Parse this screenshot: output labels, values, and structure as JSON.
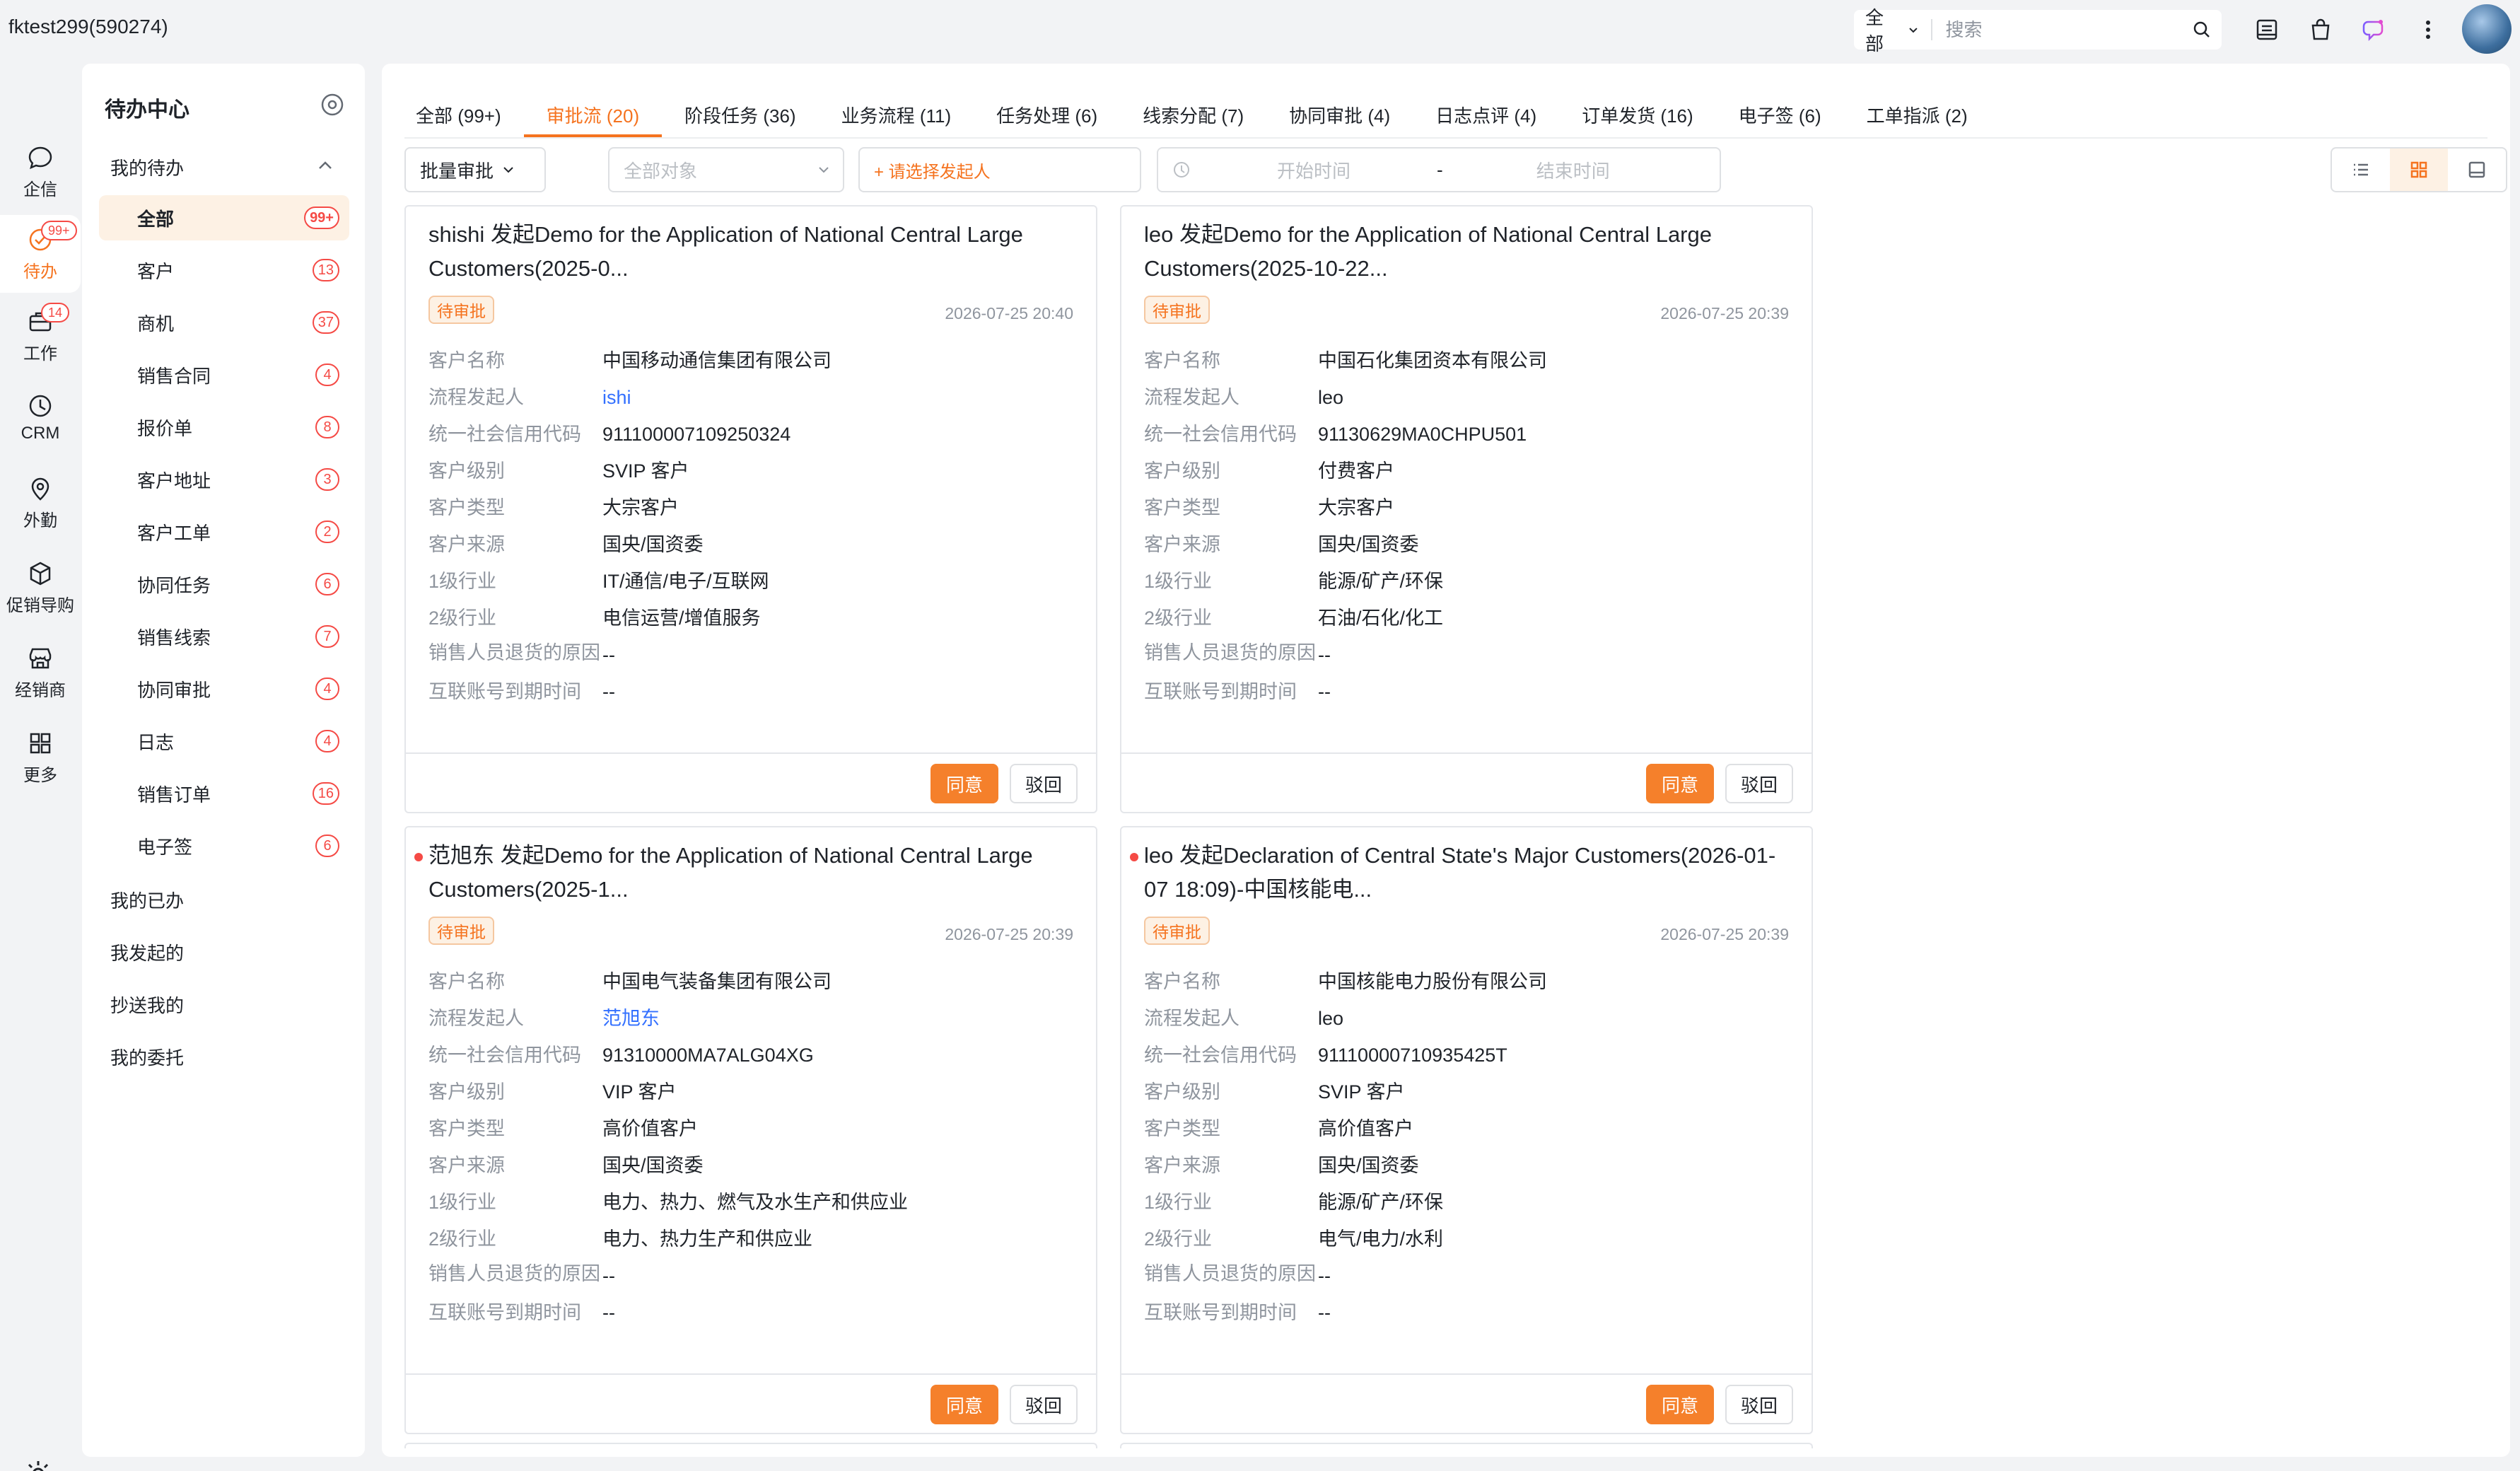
{
  "header": {
    "account": "fktest299(590274)",
    "search_scope": "全部",
    "search_placeholder": "搜索"
  },
  "rail": [
    {
      "label": "企信",
      "icon": "chat-bubble-icon"
    },
    {
      "label": "待办",
      "icon": "check-circle-icon",
      "badge": "99+",
      "active": true
    },
    {
      "label": "工作",
      "icon": "briefcase-icon",
      "badge": "14"
    },
    {
      "label": "CRM",
      "icon": "clock-icon"
    },
    {
      "label": "外勤",
      "icon": "location-pin-icon"
    },
    {
      "label": "促销导购",
      "icon": "cube-icon"
    },
    {
      "label": "经销商",
      "icon": "store-icon"
    },
    {
      "label": "更多",
      "icon": "grid-icon"
    }
  ],
  "sidebar": {
    "title": "待办中心",
    "my_todo": "我的待办",
    "items": [
      {
        "label": "全部",
        "count": "99+"
      },
      {
        "label": "客户",
        "count": "13"
      },
      {
        "label": "商机",
        "count": "37"
      },
      {
        "label": "销售合同",
        "count": "4"
      },
      {
        "label": "报价单",
        "count": "8"
      },
      {
        "label": "客户地址",
        "count": "3"
      },
      {
        "label": "客户工单",
        "count": "2"
      },
      {
        "label": "协同任务",
        "count": "6"
      },
      {
        "label": "销售线索",
        "count": "7"
      },
      {
        "label": "协同审批",
        "count": "4"
      },
      {
        "label": "日志",
        "count": "4"
      },
      {
        "label": "销售订单",
        "count": "16"
      },
      {
        "label": "电子签",
        "count": "6"
      }
    ],
    "groups": [
      "我的已办",
      "我发起的",
      "抄送我的",
      "我的委托"
    ]
  },
  "tabs": [
    {
      "label": "全部 (99+)"
    },
    {
      "label": "审批流 (20)",
      "active": true
    },
    {
      "label": "阶段任务 (36)"
    },
    {
      "label": "业务流程 (11)"
    },
    {
      "label": "任务处理 (6)"
    },
    {
      "label": "线索分配 (7)"
    },
    {
      "label": "协同审批 (4)"
    },
    {
      "label": "日志点评 (4)"
    },
    {
      "label": "订单发货 (16)"
    },
    {
      "label": "电子签 (6)"
    },
    {
      "label": "工单指派 (2)"
    }
  ],
  "filters": {
    "batch": "批量审批",
    "object_placeholder": "全部对象",
    "initiator_placeholder": "+ 请选择发起人",
    "start_placeholder": "开始时间",
    "date_sep": "-",
    "end_placeholder": "结束时间"
  },
  "field_labels": {
    "customer": "客户名称",
    "initiator": "流程发起人",
    "credit_code": "统一社会信用代码",
    "level": "客户级别",
    "type": "客户类型",
    "source": "客户来源",
    "industry1": "1级行业",
    "industry2": "2级行业",
    "return_reason": "销售人员退货的原因",
    "expire": "互联账号到期时间"
  },
  "buttons": {
    "agree": "同意",
    "reject": "驳回"
  },
  "cards": [
    {
      "title": "shishi 发起Demo for the Application of National Central Large Customers(2025-0...",
      "status": "待审批",
      "time": "2026-07-25 20:40",
      "unread": false,
      "customer": "中国移动通信集团有限公司",
      "initiator": "ishi",
      "initiator_link": true,
      "credit_code": "911100007109250324",
      "level": "SVIP 客户",
      "type": "大宗客户",
      "source": "国央/国资委",
      "industry1": "IT/通信/电子/互联网",
      "industry2": "电信运营/增值服务",
      "return_reason": "--",
      "expire": "--"
    },
    {
      "title": "leo 发起Demo for the Application of National Central Large Customers(2025-10-22...",
      "status": "待审批",
      "time": "2026-07-25 20:39",
      "unread": false,
      "customer": "中国石化集团资本有限公司",
      "initiator": "leo",
      "initiator_link": false,
      "credit_code": "91130629MA0CHPU501",
      "level": "付费客户",
      "type": "大宗客户",
      "source": "国央/国资委",
      "industry1": "能源/矿产/环保",
      "industry2": "石油/石化/化工",
      "return_reason": "--",
      "expire": "--"
    },
    {
      "title": "范旭东 发起Demo for the Application of National Central Large Customers(2025-1...",
      "status": "待审批",
      "time": "2026-07-25 20:39",
      "unread": true,
      "customer": "中国电气装备集团有限公司",
      "initiator": "范旭东",
      "initiator_link": true,
      "credit_code": "91310000MA7ALG04XG",
      "level": "VIP 客户",
      "type": "高价值客户",
      "source": "国央/国资委",
      "industry1": "电力、热力、燃气及水生产和供应业",
      "industry2": "电力、热力生产和供应业",
      "return_reason": "--",
      "expire": "--"
    },
    {
      "title": "leo 发起Declaration of Central State's Major Customers(2026-01-07 18:09)-中国核能电...",
      "status": "待审批",
      "time": "2026-07-25 20:39",
      "unread": true,
      "customer": "中国核能电力股份有限公司",
      "initiator": "leo",
      "initiator_link": false,
      "credit_code": "91110000710935425T",
      "level": "SVIP 客户",
      "type": "高价值客户",
      "source": "国央/国资委",
      "industry1": "能源/矿产/环保",
      "industry2": "电气/电力/水利",
      "return_reason": "--",
      "expire": "--"
    }
  ],
  "colors": {
    "accent": "#f5731f",
    "badge": "#f54a45",
    "link": "#3370ff"
  }
}
